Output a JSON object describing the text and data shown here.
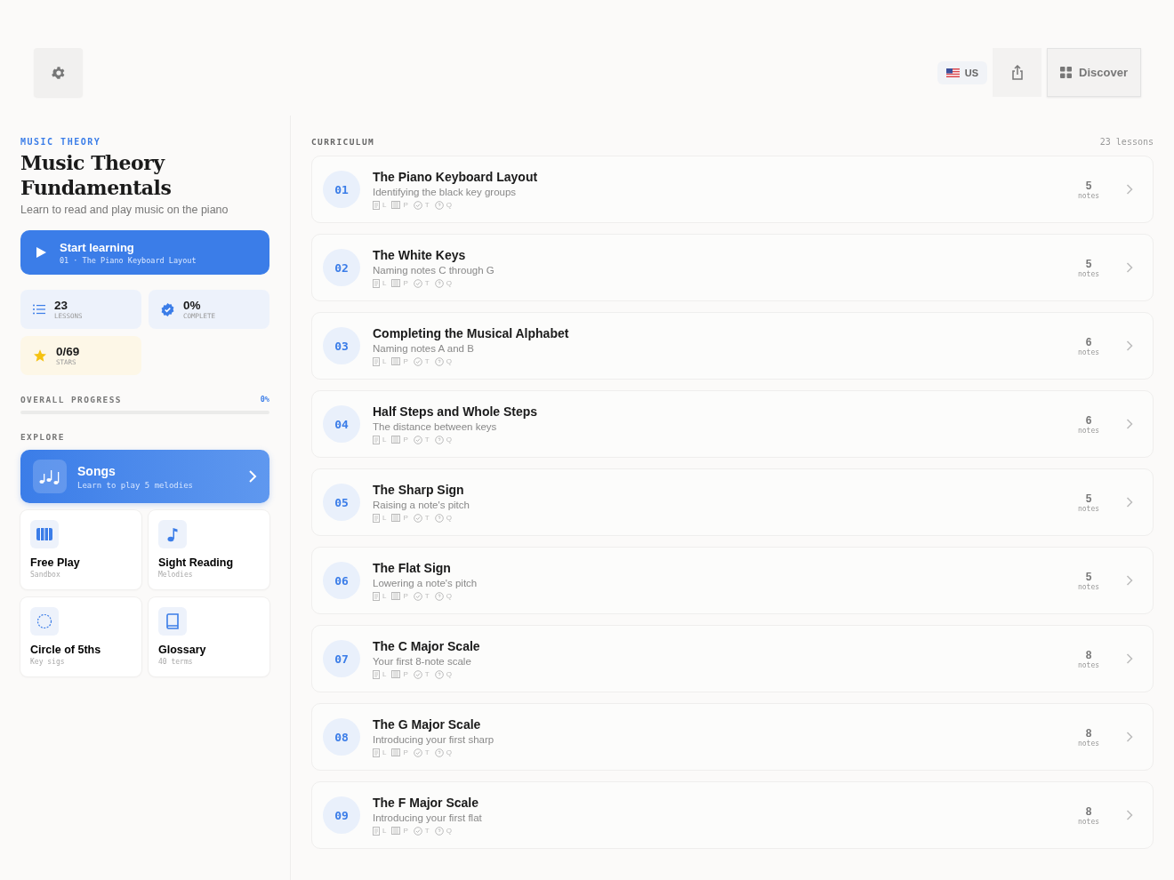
{
  "header": {
    "locale": "US",
    "discover": "Discover"
  },
  "sidebar": {
    "eyebrow": "MUSIC THEORY",
    "title": "Music Theory Fundamentals",
    "subtitle": "Learn to read and play music on the piano",
    "start": {
      "label": "Start learning",
      "detail": "01 · The Piano Keyboard Layout"
    },
    "stats": [
      {
        "kind": "lessons",
        "value": "23",
        "label": "LESSONS"
      },
      {
        "kind": "complete",
        "value": "0%",
        "label": "COMPLETE"
      },
      {
        "kind": "stars",
        "value": "0/69",
        "label": "STARS"
      }
    ],
    "progress": {
      "label": "OVERALL PROGRESS",
      "reading": "0%",
      "level": 0
    },
    "explore_label": "EXPLORE",
    "featured": {
      "title": "Songs",
      "subtitle": "Learn to play 5 melodies"
    },
    "tiles": [
      {
        "kind": "piano",
        "title": "Free Play",
        "subtitle": "Sandbox"
      },
      {
        "kind": "note",
        "title": "Sight Reading",
        "subtitle": "Melodies"
      },
      {
        "kind": "circle",
        "title": "Circle of 5ths",
        "subtitle": "Key sigs"
      },
      {
        "kind": "book",
        "title": "Glossary",
        "subtitle": "40 terms"
      }
    ]
  },
  "curriculum": {
    "label": "CURRICULUM",
    "count": "23 lessons",
    "lessons": [
      {
        "number": "01",
        "title": "The Piano Keyboard Layout",
        "subtitle": "Identifying the black key groups",
        "tags": [
          "L",
          "P",
          "T",
          "Q"
        ],
        "notes": "5",
        "notes_label": "notes"
      },
      {
        "number": "02",
        "title": "The White Keys",
        "subtitle": "Naming notes C through G",
        "tags": [
          "L",
          "P",
          "T",
          "Q"
        ],
        "notes": "5",
        "notes_label": "notes"
      },
      {
        "number": "03",
        "title": "Completing the Musical Alphabet",
        "subtitle": "Naming notes A and B",
        "tags": [
          "L",
          "P",
          "T",
          "Q"
        ],
        "notes": "6",
        "notes_label": "notes"
      },
      {
        "number": "04",
        "title": "Half Steps and Whole Steps",
        "subtitle": "The distance between keys",
        "tags": [
          "L",
          "P",
          "T",
          "Q"
        ],
        "notes": "6",
        "notes_label": "notes"
      },
      {
        "number": "05",
        "title": "The Sharp Sign",
        "subtitle": "Raising a note's pitch",
        "tags": [
          "L",
          "P",
          "T",
          "Q"
        ],
        "notes": "5",
        "notes_label": "notes"
      },
      {
        "number": "06",
        "title": "The Flat Sign",
        "subtitle": "Lowering a note's pitch",
        "tags": [
          "L",
          "P",
          "T",
          "Q"
        ],
        "notes": "5",
        "notes_label": "notes"
      },
      {
        "number": "07",
        "title": "The C Major Scale",
        "subtitle": "Your first 8-note scale",
        "tags": [
          "L",
          "P",
          "T",
          "Q"
        ],
        "notes": "8",
        "notes_label": "notes"
      },
      {
        "number": "08",
        "title": "The G Major Scale",
        "subtitle": "Introducing your first sharp",
        "tags": [
          "L",
          "P",
          "T",
          "Q"
        ],
        "notes": "8",
        "notes_label": "notes"
      },
      {
        "number": "09",
        "title": "The F Major Scale",
        "subtitle": "Introducing your first flat",
        "tags": [
          "L",
          "P",
          "T",
          "Q"
        ],
        "notes": "8",
        "notes_label": "notes"
      }
    ]
  }
}
